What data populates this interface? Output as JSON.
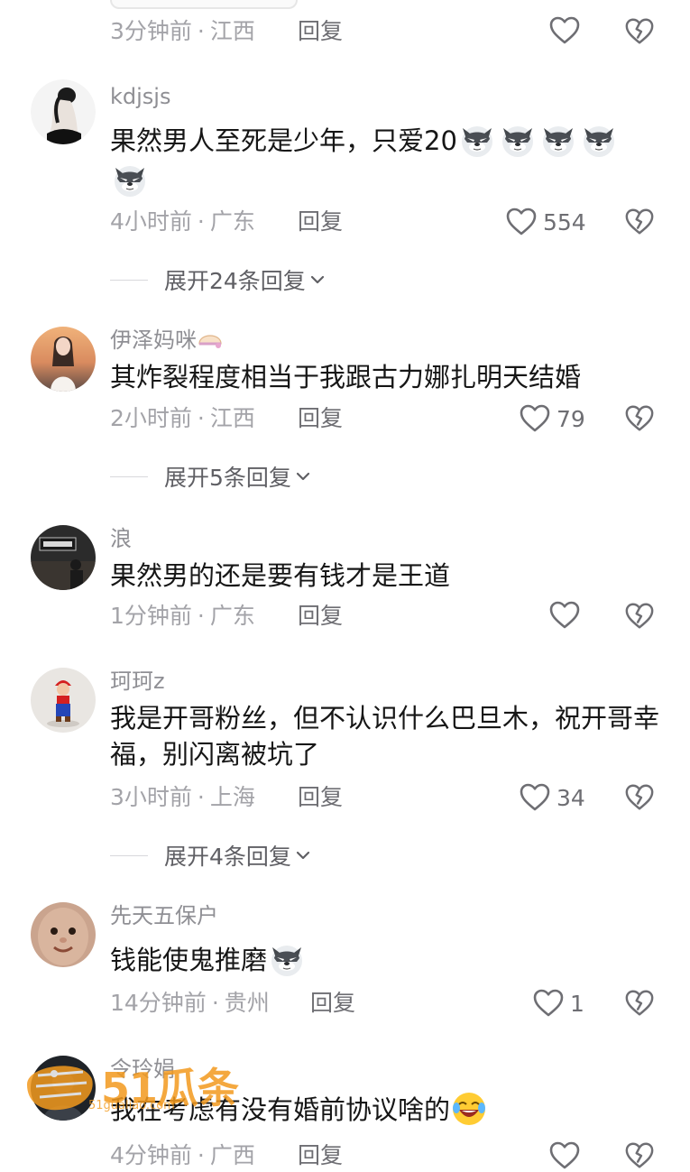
{
  "top_partial": {
    "time": "3分钟前",
    "location": "江西",
    "reply_label": "回复"
  },
  "comments": [
    {
      "username": "kdjsjs",
      "text": "果然男人至死是少年，只爱20",
      "time": "4小时前",
      "location": "广东",
      "reply_label": "回复",
      "likes": "554",
      "expand_label": "展开24条回复"
    },
    {
      "username": "伊泽妈咪",
      "text": "其炸裂程度相当于我跟古力娜扎明天结婚",
      "time": "2小时前",
      "location": "江西",
      "reply_label": "回复",
      "likes": "79",
      "expand_label": "展开5条回复"
    },
    {
      "username": "浪",
      "text": "果然男的还是要有钱才是王道",
      "time": "1分钟前",
      "location": "广东",
      "reply_label": "回复"
    },
    {
      "username": "珂珂z",
      "text": "我是开哥粉丝，但不认识什么巴旦木，祝开哥幸福，别闪离被坑了",
      "time": "3小时前",
      "location": "上海",
      "reply_label": "回复",
      "likes": "34",
      "expand_label": "展开4条回复"
    },
    {
      "username": "先天五保户",
      "text": "钱能使鬼推磨",
      "time": "14分钟前",
      "location": "贵州",
      "reply_label": "回复",
      "likes": "1"
    },
    {
      "username": "令玲娟",
      "text": "我在考虑有没有婚前协议啥的",
      "time": "4分钟前",
      "location": "广西",
      "reply_label": "回复"
    }
  ],
  "watermark": {
    "brand": "51瓜条",
    "url": "51gualiao.com"
  },
  "icons": {
    "like": "heart-outline-icon",
    "dislike": "broken-heart-icon",
    "expand": "chevron-down-icon",
    "emoji": "wolf-face-emoji"
  },
  "colors": {
    "meta_text": "#a3a3a8",
    "username": "#8f8f94",
    "body_text": "#161616",
    "watermark": "#f39a1e"
  }
}
